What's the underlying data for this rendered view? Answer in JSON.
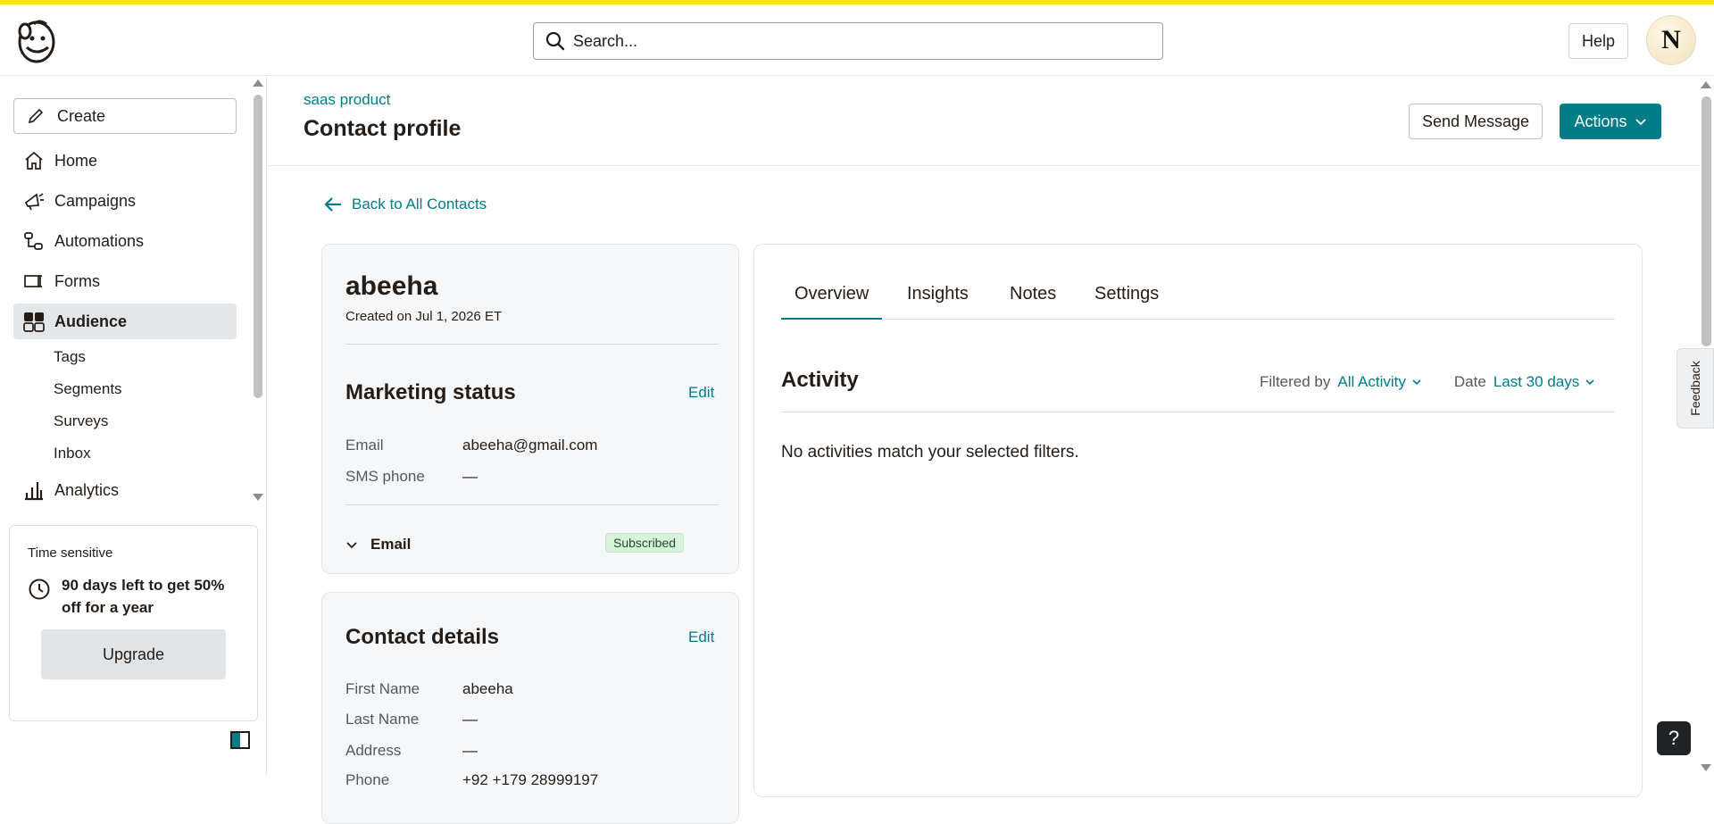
{
  "header": {
    "search_placeholder": "Search...",
    "help_label": "Help",
    "avatar_initial": "N",
    "accent_color": "#ffe01b"
  },
  "sidebar": {
    "create_label": "Create",
    "items": [
      {
        "label": "Home",
        "icon": "home-icon"
      },
      {
        "label": "Campaigns",
        "icon": "megaphone-icon"
      },
      {
        "label": "Automations",
        "icon": "automation-icon"
      },
      {
        "label": "Forms",
        "icon": "form-icon"
      },
      {
        "label": "Audience",
        "icon": "audience-icon",
        "active": true
      },
      {
        "label": "Analytics",
        "icon": "bar-chart-icon"
      }
    ],
    "audience_sub": [
      "Tags",
      "Segments",
      "Surveys",
      "Inbox"
    ],
    "promo": {
      "label": "Time sensitive",
      "text": "90 days left to get 50% off for a year",
      "button": "Upgrade"
    }
  },
  "main": {
    "breadcrumb": "saas product",
    "title": "Contact profile",
    "send_message": "Send Message",
    "actions": "Actions",
    "back_link": "Back to All Contacts",
    "contact": {
      "name": "abeeha",
      "created_on": "Created on Jul 1, 2026 ET"
    },
    "marketing": {
      "title": "Marketing status",
      "edit": "Edit",
      "email_label": "Email",
      "email_value": "abeeha@gmail.com",
      "sms_label": "SMS phone",
      "sms_value": "—",
      "channel": "Email",
      "channel_status": "Subscribed"
    },
    "details": {
      "title": "Contact details",
      "edit": "Edit",
      "first_name_label": "First Name",
      "first_name_value": "abeeha",
      "last_name_label": "Last Name",
      "last_name_value": "—",
      "address_label": "Address",
      "address_value": "—",
      "phone_label": "Phone",
      "phone_value": "+92 +179 28999197"
    },
    "tabs": [
      "Overview",
      "Insights",
      "Notes",
      "Settings"
    ],
    "activity": {
      "title": "Activity",
      "filtered_by_label": "Filtered by",
      "filtered_by_value": "All Activity",
      "date_label": "Date",
      "date_value": "Last 30 days",
      "empty_message": "No activities match your selected filters."
    },
    "brand_color": "#007c89"
  },
  "floating": {
    "feedback_label": "Feedback",
    "help_glyph": "?"
  }
}
